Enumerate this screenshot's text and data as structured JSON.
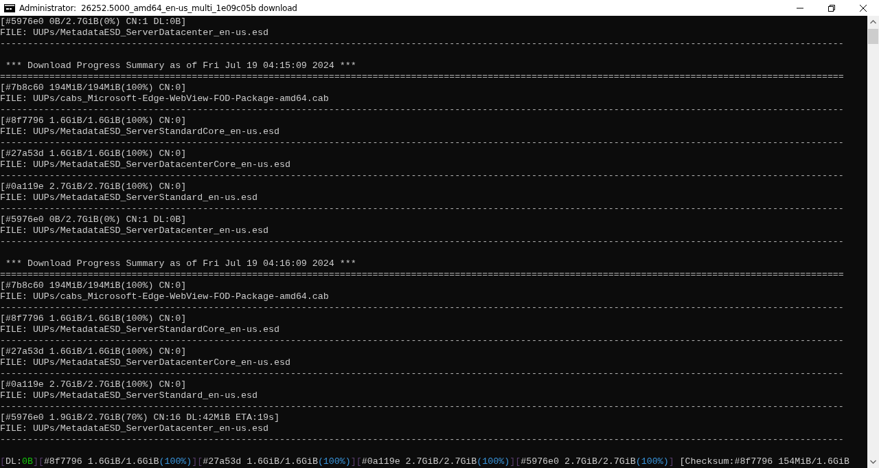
{
  "window": {
    "title": "Administrator:  26252.5000_amd64_en-us_multi_1e09c05b download"
  },
  "console": {
    "lines": [
      {
        "kind": "text",
        "text": "[#5976e0 0B/2.7GiB(0%) CN:1 DL:0B]"
      },
      {
        "kind": "text",
        "text": "FILE: UUPs/MetadataESD_ServerDatacenter_en-us.esd"
      },
      {
        "kind": "rule",
        "text": "----------------------------------------------------------------------------------------------------------------------------------------------------------"
      },
      {
        "kind": "blank"
      },
      {
        "kind": "text",
        "text": " *** Download Progress Summary as of Fri Jul 19 04:15:09 2024 ***"
      },
      {
        "kind": "rule",
        "text": "=========================================================================================================================================================="
      },
      {
        "kind": "text",
        "text": "[#7b8c60 194MiB/194MiB(100%) CN:0]"
      },
      {
        "kind": "text",
        "text": "FILE: UUPs/cabs_Microsoft-Edge-WebView-FOD-Package-amd64.cab"
      },
      {
        "kind": "rule",
        "text": "----------------------------------------------------------------------------------------------------------------------------------------------------------"
      },
      {
        "kind": "text",
        "text": "[#8f7796 1.6GiB/1.6GiB(100%) CN:0]"
      },
      {
        "kind": "text",
        "text": "FILE: UUPs/MetadataESD_ServerStandardCore_en-us.esd"
      },
      {
        "kind": "rule",
        "text": "----------------------------------------------------------------------------------------------------------------------------------------------------------"
      },
      {
        "kind": "text",
        "text": "[#27a53d 1.6GiB/1.6GiB(100%) CN:0]"
      },
      {
        "kind": "text",
        "text": "FILE: UUPs/MetadataESD_ServerDatacenterCore_en-us.esd"
      },
      {
        "kind": "rule",
        "text": "----------------------------------------------------------------------------------------------------------------------------------------------------------"
      },
      {
        "kind": "text",
        "text": "[#0a119e 2.7GiB/2.7GiB(100%) CN:0]"
      },
      {
        "kind": "text",
        "text": "FILE: UUPs/MetadataESD_ServerStandard_en-us.esd"
      },
      {
        "kind": "rule",
        "text": "----------------------------------------------------------------------------------------------------------------------------------------------------------"
      },
      {
        "kind": "text",
        "text": "[#5976e0 0B/2.7GiB(0%) CN:1 DL:0B]"
      },
      {
        "kind": "text",
        "text": "FILE: UUPs/MetadataESD_ServerDatacenter_en-us.esd"
      },
      {
        "kind": "rule",
        "text": "----------------------------------------------------------------------------------------------------------------------------------------------------------"
      },
      {
        "kind": "blank"
      },
      {
        "kind": "text",
        "text": " *** Download Progress Summary as of Fri Jul 19 04:16:09 2024 ***"
      },
      {
        "kind": "rule",
        "text": "=========================================================================================================================================================="
      },
      {
        "kind": "text",
        "text": "[#7b8c60 194MiB/194MiB(100%) CN:0]"
      },
      {
        "kind": "text",
        "text": "FILE: UUPs/cabs_Microsoft-Edge-WebView-FOD-Package-amd64.cab"
      },
      {
        "kind": "rule",
        "text": "----------------------------------------------------------------------------------------------------------------------------------------------------------"
      },
      {
        "kind": "text",
        "text": "[#8f7796 1.6GiB/1.6GiB(100%) CN:0]"
      },
      {
        "kind": "text",
        "text": "FILE: UUPs/MetadataESD_ServerStandardCore_en-us.esd"
      },
      {
        "kind": "rule",
        "text": "----------------------------------------------------------------------------------------------------------------------------------------------------------"
      },
      {
        "kind": "text",
        "text": "[#27a53d 1.6GiB/1.6GiB(100%) CN:0]"
      },
      {
        "kind": "text",
        "text": "FILE: UUPs/MetadataESD_ServerDatacenterCore_en-us.esd"
      },
      {
        "kind": "rule",
        "text": "----------------------------------------------------------------------------------------------------------------------------------------------------------"
      },
      {
        "kind": "text",
        "text": "[#0a119e 2.7GiB/2.7GiB(100%) CN:0]"
      },
      {
        "kind": "text",
        "text": "FILE: UUPs/MetadataESD_ServerStandard_en-us.esd"
      },
      {
        "kind": "rule",
        "text": "----------------------------------------------------------------------------------------------------------------------------------------------------------"
      },
      {
        "kind": "text",
        "text": "[#5976e0 1.9GiB/2.7GiB(70%) CN:16 DL:42MiB ETA:19s]"
      },
      {
        "kind": "text",
        "text": "FILE: UUPs/MetadataESD_ServerDatacenter_en-us.esd"
      },
      {
        "kind": "rule",
        "text": "----------------------------------------------------------------------------------------------------------------------------------------------------------"
      },
      {
        "kind": "blank"
      }
    ],
    "status_line": [
      {
        "kind": "bracket",
        "text": "["
      },
      {
        "kind": "plain",
        "text": "DL:"
      },
      {
        "kind": "ok",
        "text": "0B"
      },
      {
        "kind": "bracket",
        "text": "]["
      },
      {
        "kind": "plain",
        "text": "#8f7796 1.6GiB/1.6GiB"
      },
      {
        "kind": "percent",
        "text": "(100%)"
      },
      {
        "kind": "bracket",
        "text": "]["
      },
      {
        "kind": "plain",
        "text": "#27a53d 1.6GiB/1.6GiB"
      },
      {
        "kind": "percent",
        "text": "(100%)"
      },
      {
        "kind": "bracket",
        "text": "]["
      },
      {
        "kind": "plain",
        "text": "#0a119e 2.7GiB/2.7GiB"
      },
      {
        "kind": "percent",
        "text": "(100%)"
      },
      {
        "kind": "bracket",
        "text": "]["
      },
      {
        "kind": "plain",
        "text": "#5976e0 2.7GiB/2.7GiB"
      },
      {
        "kind": "percent",
        "text": "(100%)"
      },
      {
        "kind": "bracket",
        "text": "]"
      },
      {
        "kind": "plain",
        "text": " [Checksum:#8f7796 154MiB/1.6GiB"
      }
    ]
  }
}
